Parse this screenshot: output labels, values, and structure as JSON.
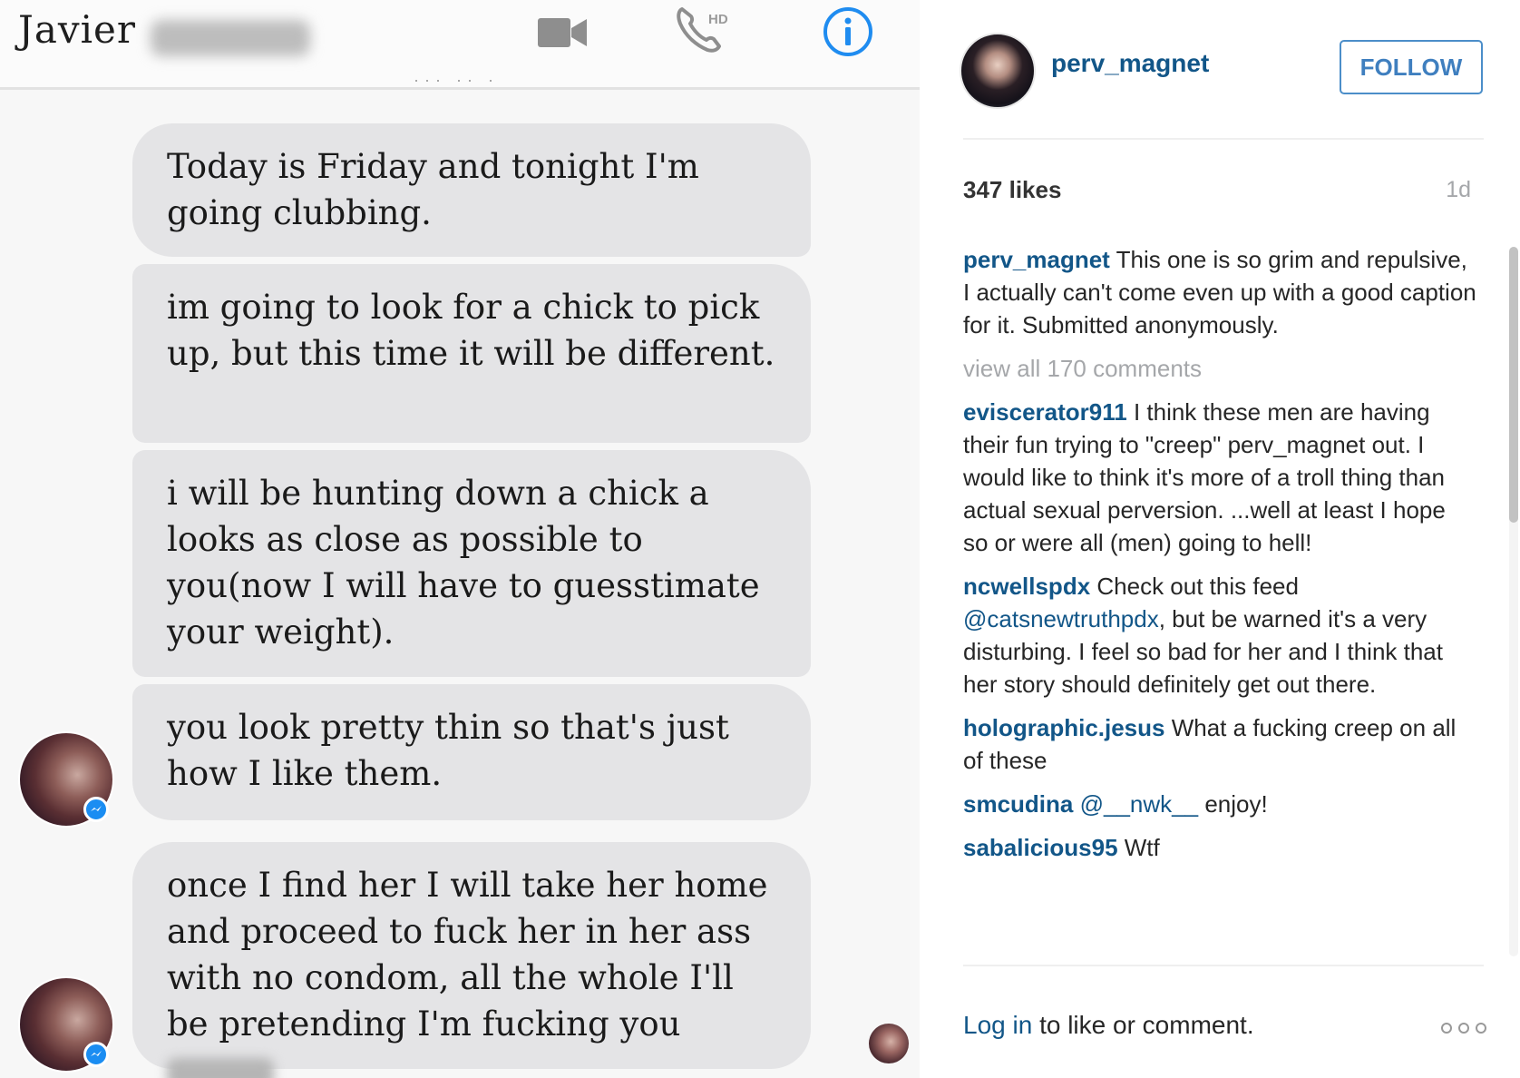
{
  "chat": {
    "contact_name": "Javier",
    "cut_text": "··· ·· ·",
    "messages": [
      "Today is Friday and tonight I'm going clubbing.",
      "im going to look for a chick to pick up, but this time it will be different.",
      "i will be hunting down a chick a looks as close as possible to you(now I will have to guesstimate your weight).",
      "you look pretty thin so that's just how I like them.",
      "once I find her I will take her home and proceed to fuck her in her ass with no condom, all the whole I'll be pretending I'm fucking you"
    ],
    "icons": {
      "video": "video-camera-icon",
      "phone": "hd-phone-icon",
      "phone_badge": "HD",
      "info": "info-icon"
    }
  },
  "post": {
    "username": "perv_magnet",
    "follow_label": "FOLLOW",
    "likes": "347 likes",
    "age": "1d",
    "caption_user": "perv_magnet",
    "caption_text": " This one is so grim and repulsive, I actually can't come even up with a good caption for it. Submitted anonymously.",
    "view_all": "view all 170 comments",
    "comments": [
      {
        "user": "eviscerator911",
        "text": " I think these men are having their fun trying to \"creep\" perv_magnet out. I would like to think it's more of a troll thing than actual sexual perversion. ...well at least I hope so or were all (men) going to hell!"
      },
      {
        "user": "ncwellspdx",
        "text_before": " Check out this feed ",
        "mention": "@catsnewtruthpdx",
        "text": ", but be warned it's a very disturbing. I feel so bad for her and I think that her story should definitely get out there."
      },
      {
        "user": "holographic.jesus",
        "text": " What a fucking creep on all of these"
      },
      {
        "user": "smcudina",
        "mention": "@__nwk__",
        "text": " enjoy!"
      },
      {
        "user": "sabalicious95",
        "text": " Wtf"
      }
    ],
    "login_link": "Log in",
    "login_text": " to like or comment.",
    "accent_color": "#125688",
    "button_color": "#3f7fbf"
  }
}
